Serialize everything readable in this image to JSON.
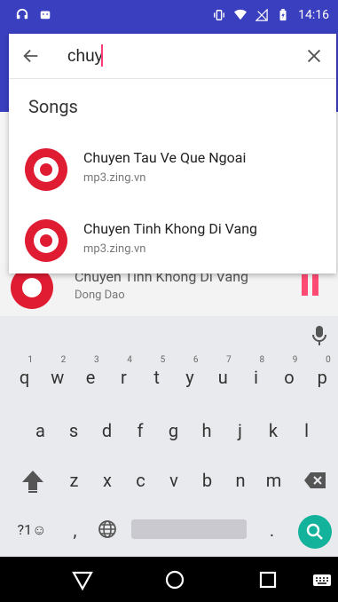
{
  "status_bar": {
    "time": "14:16",
    "left_icons": [
      "headset-icon",
      "android-icon"
    ],
    "right_icons": [
      "vibrate-icon",
      "wifi-icon",
      "no-signal-icon",
      "battery-charging-icon"
    ]
  },
  "search": {
    "query": "chuy",
    "back_icon": "arrow-back-icon",
    "clear_icon": "close-icon"
  },
  "section_title": "Songs",
  "results": [
    {
      "title": "Chuyen Tau Ve Que Ngoai",
      "subtitle": "mp3.zing.vn"
    },
    {
      "title": "Chuyen Tinh Khong Di Vang",
      "subtitle": "mp3.zing.vn"
    }
  ],
  "now_playing": {
    "title": "Chuyen Tinh Khong Di Vang",
    "artist": "Dong Dao"
  },
  "keyboard": {
    "row1": [
      "q",
      "w",
      "e",
      "r",
      "t",
      "y",
      "u",
      "i",
      "o",
      "p"
    ],
    "row1_sup": [
      "1",
      "2",
      "3",
      "4",
      "5",
      "6",
      "7",
      "8",
      "9",
      "0"
    ],
    "row2": [
      "a",
      "s",
      "d",
      "f",
      "g",
      "h",
      "j",
      "k",
      "l"
    ],
    "row3": [
      "z",
      "x",
      "c",
      "v",
      "b",
      "n",
      "m"
    ],
    "symbols_key": "?1☺",
    "comma_key": ",",
    "period_key": "."
  },
  "colors": {
    "app_bar": "#3a3fbf",
    "accent": "#ff3c73",
    "beats_red": "#e01c33",
    "enter": "#12b29b"
  }
}
